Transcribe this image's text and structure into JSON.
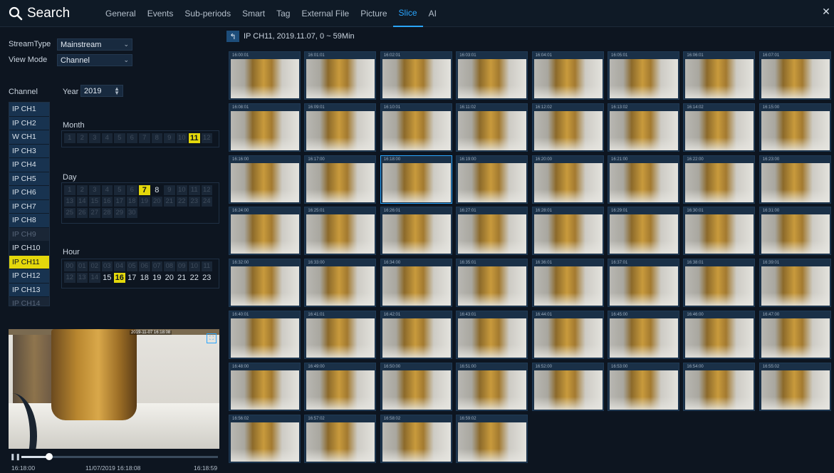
{
  "header": {
    "title": "Search",
    "tabs": [
      "General",
      "Events",
      "Sub-periods",
      "Smart",
      "Tag",
      "External File",
      "Picture",
      "Slice",
      "AI"
    ],
    "active_tab": "Slice"
  },
  "filters": {
    "stream_type_label": "StreamType",
    "stream_type_value": "Mainstream",
    "view_mode_label": "View Mode",
    "view_mode_value": "Channel",
    "channel_label": "Channel",
    "year_label": "Year",
    "year_value": "2019"
  },
  "channels": [
    {
      "label": "IP CH1",
      "state": "normal"
    },
    {
      "label": "IP CH2",
      "state": "normal"
    },
    {
      "label": "W CH1",
      "state": "normal"
    },
    {
      "label": "IP CH3",
      "state": "normal"
    },
    {
      "label": "IP CH4",
      "state": "normal"
    },
    {
      "label": "IP CH5",
      "state": "normal"
    },
    {
      "label": "IP CH6",
      "state": "normal"
    },
    {
      "label": "IP CH7",
      "state": "normal"
    },
    {
      "label": "IP CH8",
      "state": "normal"
    },
    {
      "label": "IP CH9",
      "state": "disabled"
    },
    {
      "label": "IP CH10",
      "state": "plain"
    },
    {
      "label": "IP CH11",
      "state": "selected"
    },
    {
      "label": "IP CH12",
      "state": "normal"
    },
    {
      "label": "IP CH13",
      "state": "normal"
    },
    {
      "label": "IP CH14",
      "state": "disabled"
    }
  ],
  "month": {
    "label": "Month",
    "items": [
      "1",
      "2",
      "3",
      "4",
      "5",
      "6",
      "7",
      "8",
      "9",
      "10",
      "11",
      "12"
    ],
    "enabled": [
      "11"
    ],
    "selected": "11"
  },
  "day": {
    "label": "Day",
    "items": [
      "1",
      "2",
      "3",
      "4",
      "5",
      "6",
      "7",
      "8",
      "9",
      "10",
      "11",
      "12",
      "13",
      "14",
      "15",
      "16",
      "17",
      "18",
      "19",
      "20",
      "21",
      "22",
      "23",
      "24",
      "25",
      "26",
      "27",
      "28",
      "29",
      "30"
    ],
    "enabled": [
      "7",
      "8"
    ],
    "selected": "7"
  },
  "hour": {
    "label": "Hour",
    "items": [
      "00",
      "01",
      "02",
      "03",
      "04",
      "05",
      "06",
      "07",
      "08",
      "09",
      "10",
      "11",
      "12",
      "13",
      "14",
      "15",
      "16",
      "17",
      "18",
      "19",
      "20",
      "21",
      "22",
      "23"
    ],
    "enabled": [
      "15",
      "16",
      "17",
      "18",
      "19",
      "20",
      "21",
      "22",
      "23"
    ],
    "selected": "16"
  },
  "player": {
    "start_time": "16:18:00",
    "current_time": "11/07/2019 16:18:08",
    "end_time": "16:18:59",
    "progress": 0.14,
    "preview_stamp": "2019-11-07 16:18:08"
  },
  "breadcrumb": {
    "text": "IP CH11,  2019.11.07,  0 ~ 59Min"
  },
  "slices": {
    "columns": 8,
    "selected": "16:18:00",
    "times": [
      "16:00:01",
      "16:01:01",
      "16:02:01",
      "16:03:01",
      "16:04:01",
      "16:05:01",
      "16:06:01",
      "16:07:01",
      "16:08:01",
      "16:09:01",
      "16:10:01",
      "16:11:02",
      "16:12:02",
      "16:13:02",
      "16:14:02",
      "16:15:00",
      "16:16:00",
      "16:17:00",
      "16:18:00",
      "16:19:00",
      "16:20:00",
      "16:21:00",
      "16:22:00",
      "16:23:00",
      "16:24:00",
      "16:25:01",
      "16:26:01",
      "16:27:01",
      "16:28:01",
      "16:29:01",
      "16:30:01",
      "16:31:00",
      "16:32:00",
      "16:33:00",
      "16:34:00",
      "16:35:01",
      "16:36:01",
      "16:37:01",
      "16:38:01",
      "16:39:01",
      "16:40:01",
      "16:41:01",
      "16:42:01",
      "16:43:01",
      "16:44:01",
      "16:45:00",
      "16:46:00",
      "16:47:00",
      "16:48:00",
      "16:49:00",
      "16:50:00",
      "16:51:00",
      "16:52:00",
      "16:53:00",
      "16:54:00",
      "16:55:02",
      "16:56:02",
      "16:57:02",
      "16:58:02",
      "16:59:02"
    ]
  },
  "colors": {
    "accent": "#2aa6ff",
    "selected": "#e4d80b"
  },
  "icons": {
    "search": "search-icon",
    "close": "close-icon",
    "back": "back-arrow-icon",
    "play": "play-icon",
    "fit": "fit-screen-icon"
  }
}
